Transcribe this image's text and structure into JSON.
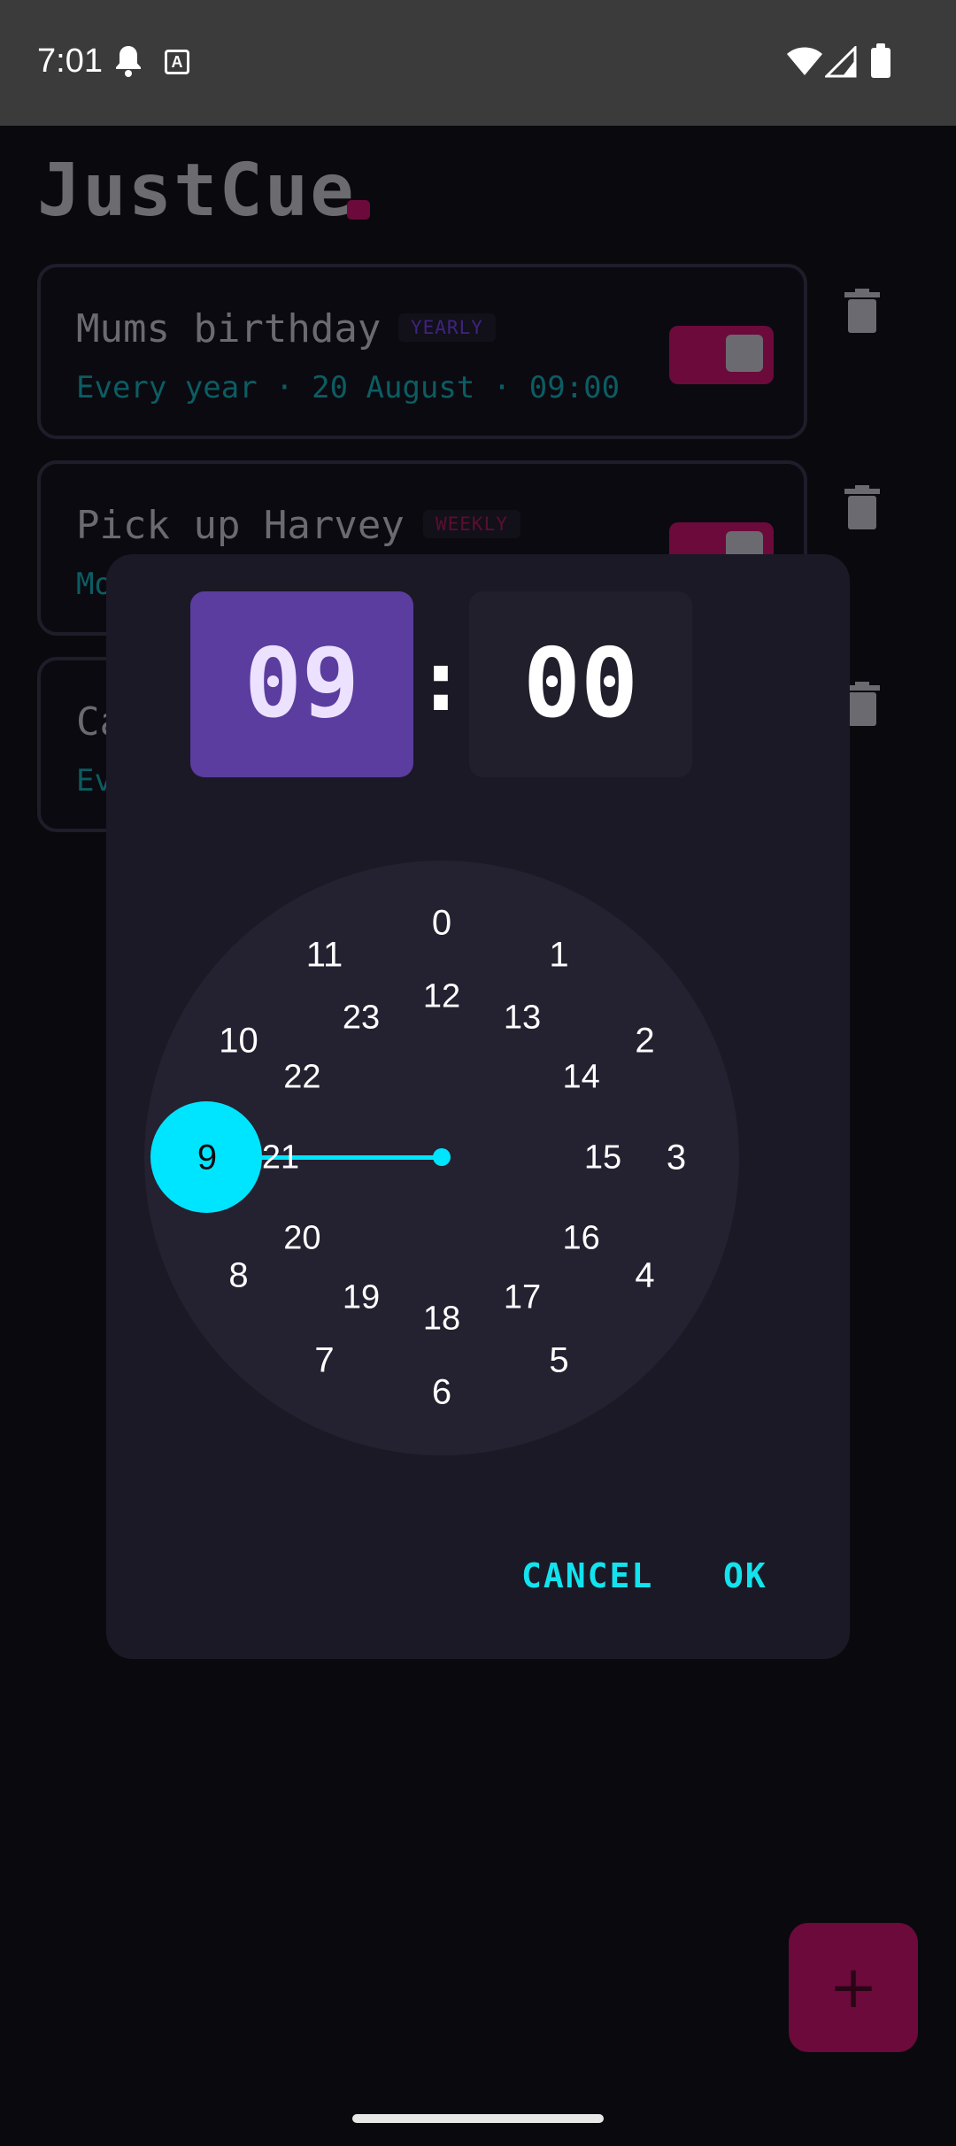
{
  "status_bar": {
    "time": "7:01",
    "icons": [
      "bell-icon",
      "text-a-icon",
      "wifi-icon",
      "signal-icon",
      "battery-icon"
    ]
  },
  "app": {
    "title": "JustCue",
    "accent_color": "#6b0a3b",
    "reminders": [
      {
        "title": "Mums birthday",
        "badge": "YEARLY",
        "subtitle": "Every year · 20 August · 09:00",
        "enabled": true
      },
      {
        "title": "Pick up Harvey",
        "badge": "WEEKLY",
        "subtitle": "Mo",
        "enabled": true
      },
      {
        "title": "Ca",
        "badge": "",
        "subtitle": "Ev",
        "enabled": null
      }
    ],
    "fab_label": "+"
  },
  "time_picker": {
    "hour": "09",
    "separator": ":",
    "minute": "00",
    "selected_value": "9",
    "outer_numbers": [
      "0",
      "1",
      "2",
      "3",
      "4",
      "5",
      "6",
      "7",
      "8",
      "9",
      "10",
      "11"
    ],
    "inner_numbers": [
      "12",
      "13",
      "14",
      "15",
      "16",
      "17",
      "18",
      "19",
      "20",
      "21",
      "22",
      "23"
    ],
    "cancel_label": "CANCEL",
    "ok_label": "OK",
    "accent_color": "#00e5ff",
    "hour_highlight_color": "#5a3d9e"
  }
}
